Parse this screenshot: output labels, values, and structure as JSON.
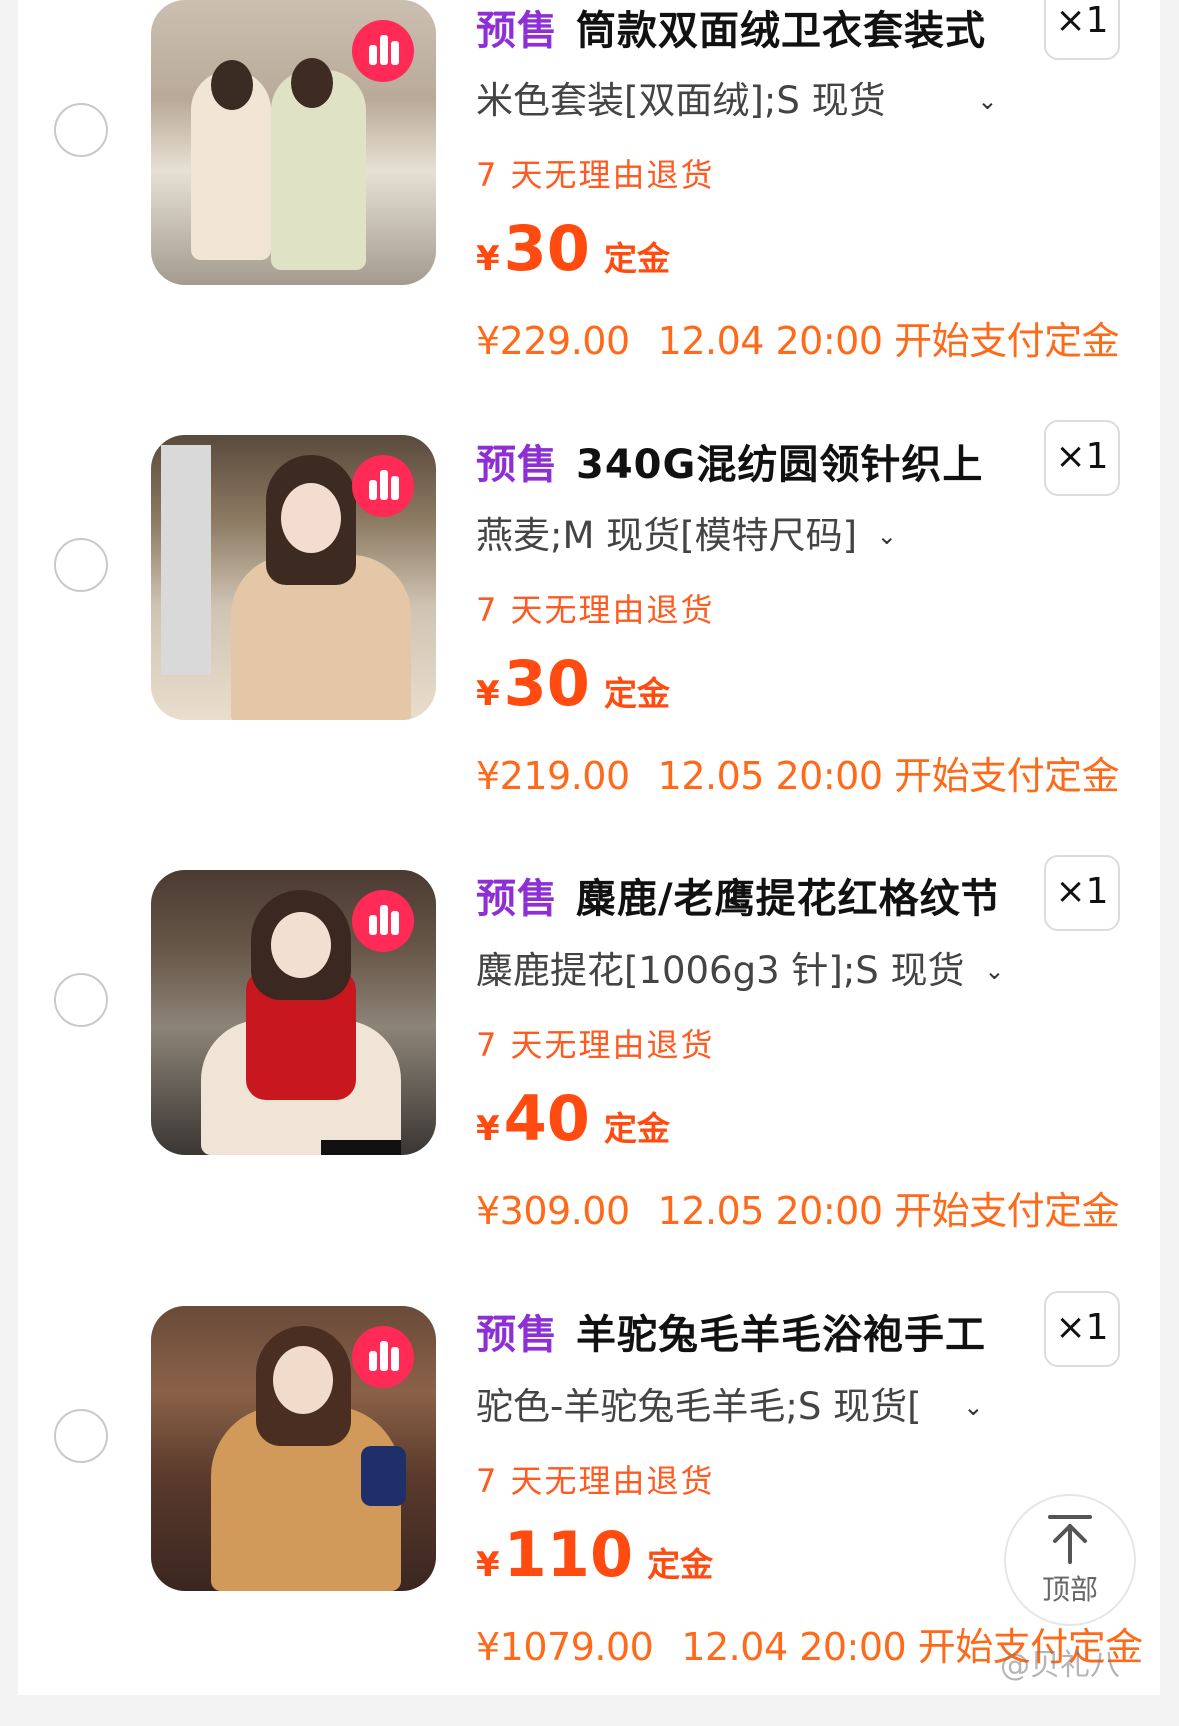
{
  "items": [
    {
      "tag": "预售",
      "title": "筒款双面绒卫衣套装式",
      "qty": "×1",
      "spec": "米色套装[双面绒];S 现货",
      "policy": "7 天无理由退货",
      "currency": "¥",
      "deposit": "30",
      "deposit_label": "定金",
      "original_price": "¥229.00",
      "pay_start": "12.04 20:00 开始支付定金"
    },
    {
      "tag": "预售",
      "title": "340G混纺圆领针织上",
      "qty": "×1",
      "spec": "燕麦;M 现货[模特尺码]",
      "policy": "7 天无理由退货",
      "currency": "¥",
      "deposit": "30",
      "deposit_label": "定金",
      "original_price": "¥219.00",
      "pay_start": "12.05 20:00 开始支付定金"
    },
    {
      "tag": "预售",
      "title": "麋鹿/老鹰提花红格纹节",
      "qty": "×1",
      "spec": "麋鹿提花[1006g3 针];S 现货",
      "policy": "7 天无理由退货",
      "currency": "¥",
      "deposit": "40",
      "deposit_label": "定金",
      "original_price": "¥309.00",
      "pay_start": "12.05 20:00 开始支付定金"
    },
    {
      "tag": "预售",
      "title": "羊驼兔毛羊毛浴袍手工",
      "qty": "×1",
      "spec": "驼色-羊驼兔毛羊毛;S 现货[",
      "policy": "7 天无理由退货",
      "currency": "¥",
      "deposit": "110",
      "deposit_label": "定金",
      "original_price": "¥1079.00",
      "pay_start": "12.04 20:00 开始支付定金"
    }
  ],
  "back_to_top": {
    "label": "顶部",
    "icon": "arrow-up-to-top-icon"
  },
  "watermark": "@贝礼八",
  "colors": {
    "presale_tag": "#8e2fd6",
    "price": "#ff4b10",
    "badge": "#ff2a55"
  }
}
